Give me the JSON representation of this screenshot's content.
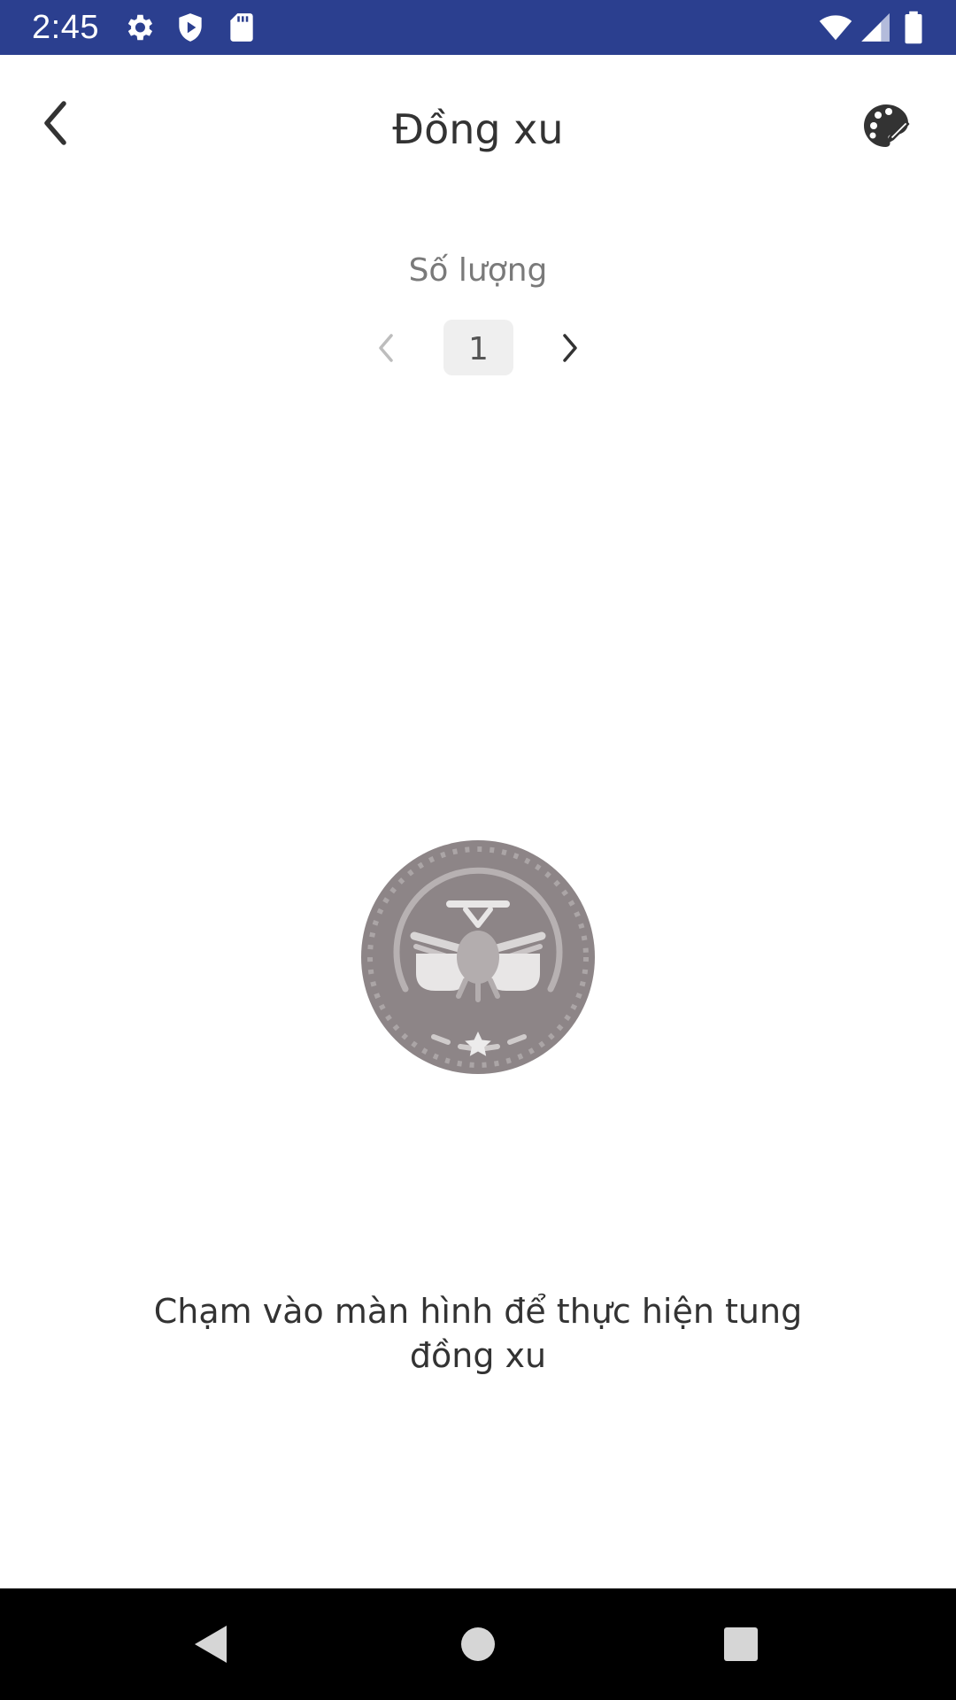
{
  "status_bar": {
    "time": "2:45",
    "background_color": "#2b3f8f",
    "left_icons": [
      "gear-icon",
      "shield-play-icon",
      "sd-card-icon"
    ],
    "right_icons": [
      "wifi-icon",
      "cell-signal-icon",
      "battery-icon"
    ]
  },
  "app_bar": {
    "title": "Đồng xu",
    "back_icon": "chevron-left-icon",
    "action_icon": "palette-icon"
  },
  "quantity": {
    "label": "Số lượng",
    "value": "1"
  },
  "coin": {
    "icon": "coin-emblem-icon",
    "color": "#8d8587"
  },
  "instruction": {
    "text": "Chạm vào màn hình để thực hiện tung đồng xu"
  },
  "nav_bar": {
    "back": "triangle-back-icon",
    "home": "circle-home-icon",
    "recents": "square-recents-icon"
  }
}
